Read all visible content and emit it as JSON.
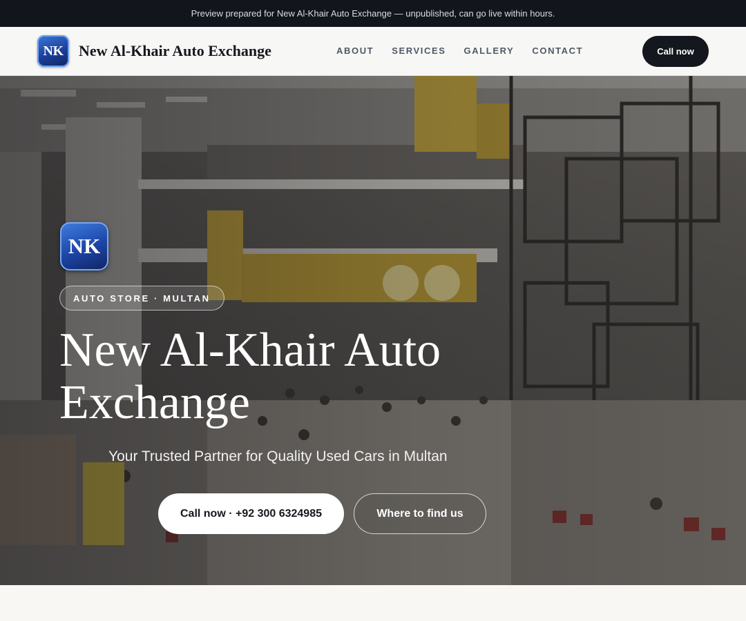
{
  "banner": {
    "text": "Preview prepared for New Al-Khair Auto Exchange — unpublished, can go live within hours."
  },
  "header": {
    "logo_text": "NK",
    "brand_name": "New Al-Khair Auto Exchange",
    "nav": [
      {
        "label": "ABOUT"
      },
      {
        "label": "SERVICES"
      },
      {
        "label": "GALLERY"
      },
      {
        "label": "CONTACT"
      }
    ],
    "cta_label": "Call now"
  },
  "hero": {
    "badge_text": "NK",
    "pill": "AUTO STORE · MULTAN",
    "title": "New Al-Khair Auto Exchange",
    "subtitle": "Your Trusted Partner for Quality Used Cars in Multan",
    "primary_button": "Call now · +92 300 6324985",
    "secondary_button": "Where to find us",
    "background_image": "shopping-mall-interior-photo"
  },
  "colors": {
    "brand_dark": "#14171d",
    "logo_blue": "#1d44a6",
    "banner_bg": "#12151c"
  }
}
